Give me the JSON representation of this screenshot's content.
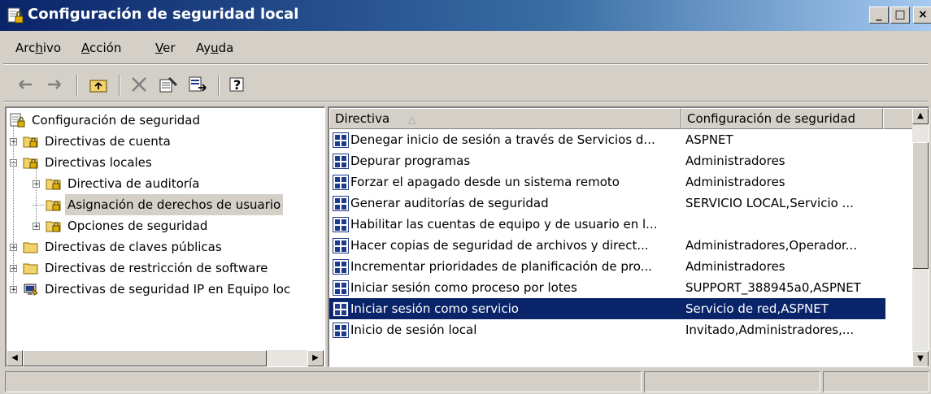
{
  "window": {
    "title": "Configuración de seguridad local",
    "min_label": "_",
    "max_label": "□",
    "close_label": "×"
  },
  "menu": [
    {
      "label": "Archivo",
      "accel_index": 3
    },
    {
      "label": "Acción",
      "accel_index": 0
    },
    {
      "label": "Ver",
      "accel_index": 0
    },
    {
      "label": "Ayuda",
      "accel_index": 2
    }
  ],
  "toolbar": {
    "back_icon": "back-arrow-icon",
    "forward_icon": "forward-arrow-icon",
    "up_icon": "up-folder-icon",
    "delete_icon": "delete-icon",
    "properties_icon": "properties-icon",
    "export_icon": "export-list-icon",
    "help_icon": "help-icon"
  },
  "tree": {
    "items": [
      {
        "label": "Configuración de seguridad",
        "level": 0,
        "expander": "",
        "icon": "security-config-icon"
      },
      {
        "label": "Directivas de cuenta",
        "level": 1,
        "expander": "+",
        "icon": "locked-folder-icon"
      },
      {
        "label": "Directivas locales",
        "level": 1,
        "expander": "−",
        "icon": "locked-folder-icon"
      },
      {
        "label": "Directiva de auditoría",
        "level": 2,
        "expander": "+",
        "icon": "locked-folder-icon"
      },
      {
        "label": "Asignación de derechos de usuario",
        "level": 2,
        "expander": "",
        "icon": "locked-folder-icon",
        "selected": true
      },
      {
        "label": "Opciones de seguridad",
        "level": 2,
        "expander": "+",
        "icon": "locked-folder-icon"
      },
      {
        "label": "Directivas de claves públicas",
        "level": 1,
        "expander": "+",
        "icon": "folder-icon"
      },
      {
        "label": "Directivas de restricción de software",
        "level": 1,
        "expander": "+",
        "icon": "folder-icon"
      },
      {
        "label": "Directivas de seguridad IP en Equipo loc",
        "level": 1,
        "expander": "+",
        "icon": "ip-security-icon"
      }
    ]
  },
  "list": {
    "columns": [
      "Directiva",
      "Configuración de seguridad"
    ],
    "sort_indicator": "△",
    "rows": [
      {
        "name": "Denegar inicio de sesión a través de Servicios d...",
        "value": "ASPNET"
      },
      {
        "name": "Depurar programas",
        "value": "Administradores"
      },
      {
        "name": "Forzar el apagado desde un sistema remoto",
        "value": "Administradores"
      },
      {
        "name": "Generar auditorías de seguridad",
        "value": "SERVICIO LOCAL,Servicio ..."
      },
      {
        "name": "Habilitar las cuentas de equipo y de usuario en l...",
        "value": ""
      },
      {
        "name": "Hacer copias de seguridad de archivos y direct...",
        "value": "Administradores,Operador..."
      },
      {
        "name": "Incrementar prioridades de planificación de pro...",
        "value": "Administradores"
      },
      {
        "name": "Iniciar sesión como proceso por lotes",
        "value": "SUPPORT_388945a0,ASPNET"
      },
      {
        "name": "Iniciar sesión como servicio",
        "value": "Servicio de red,ASPNET",
        "selected": true
      },
      {
        "name": "Inicio de sesión local",
        "value": "Invitado,Administradores,..."
      }
    ]
  },
  "colors": {
    "title_start": "#0a246a",
    "title_end": "#a6caf0",
    "selection": "#0a246a",
    "face": "#d4d0c8"
  }
}
